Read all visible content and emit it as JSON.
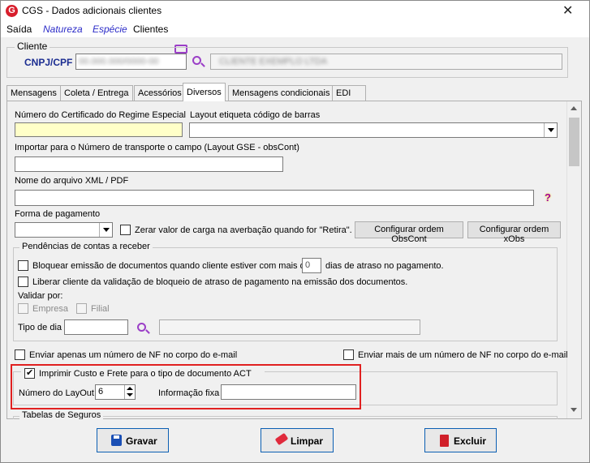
{
  "window": {
    "title": "CGS - Dados adicionais clientes"
  },
  "menu": {
    "saida": "Saída",
    "natureza": "Natureza",
    "especie": "Espécie",
    "clientes": "Clientes"
  },
  "cliente": {
    "group": "Cliente",
    "cnpj_label": "CNPJ/CPF",
    "cnpj_value": "00.000.000/0000-00",
    "name_value": "CLIENTE EXEMPLO LTDA"
  },
  "tabs": [
    "Mensagens",
    "Coleta / Entrega",
    "Acessórios",
    "Diversos",
    "Mensagens condicionais",
    "EDI"
  ],
  "diversos": {
    "cert_label": "Número do Certificado do Regime Especial",
    "layout_label": "Layout etiqueta código de barras",
    "importar_label": "Importar para o Número de transporte o campo (Layout GSE - obsCont)",
    "xml_label": "Nome do arquivo XML / PDF",
    "help": "?",
    "forma_label": "Forma de pagamento",
    "zerar_label": "Zerar valor de carga na averbação quando for \"Retira\".",
    "btn_obs": "Configurar ordem ObsCont",
    "btn_xobs": "Configurar ordem xObs",
    "pend_group": "Pendências de contas a receber",
    "bloquear_label": "Bloquear emissão de documentos quando cliente estiver com mais de",
    "dias_value": "0",
    "dias_label": "dias de atraso no pagamento.",
    "liberar_label": "Liberar cliente da validação de bloqueio de atraso de pagamento na emissão dos documentos.",
    "validar_label": "Validar por:",
    "empresa_label": "Empresa",
    "filial_label": "Filial",
    "tipo_dia_label": "Tipo de dia",
    "enviar_um_label": "Enviar apenas um número de NF no corpo do e-mail",
    "enviar_mais_label": "Enviar mais de um número de NF no corpo do e-mail",
    "imprimir_label": "Imprimir Custo e Frete para o tipo de documento ACT",
    "layout_num_label": "Número do LayOut",
    "layout_num_value": "6",
    "info_label": "Informação fixa",
    "tabelas_label": "Tabelas de Seguros"
  },
  "buttons": {
    "gravar": "Gravar",
    "limpar": "Limpar",
    "excluir": "Excluir"
  },
  "colors": {
    "accent_blue": "#1b2d91",
    "menu_link": "#2d2dc8",
    "highlight": "#e02020",
    "yellow_field": "#ffffc8",
    "icon_purple": "#9b3fc7"
  }
}
